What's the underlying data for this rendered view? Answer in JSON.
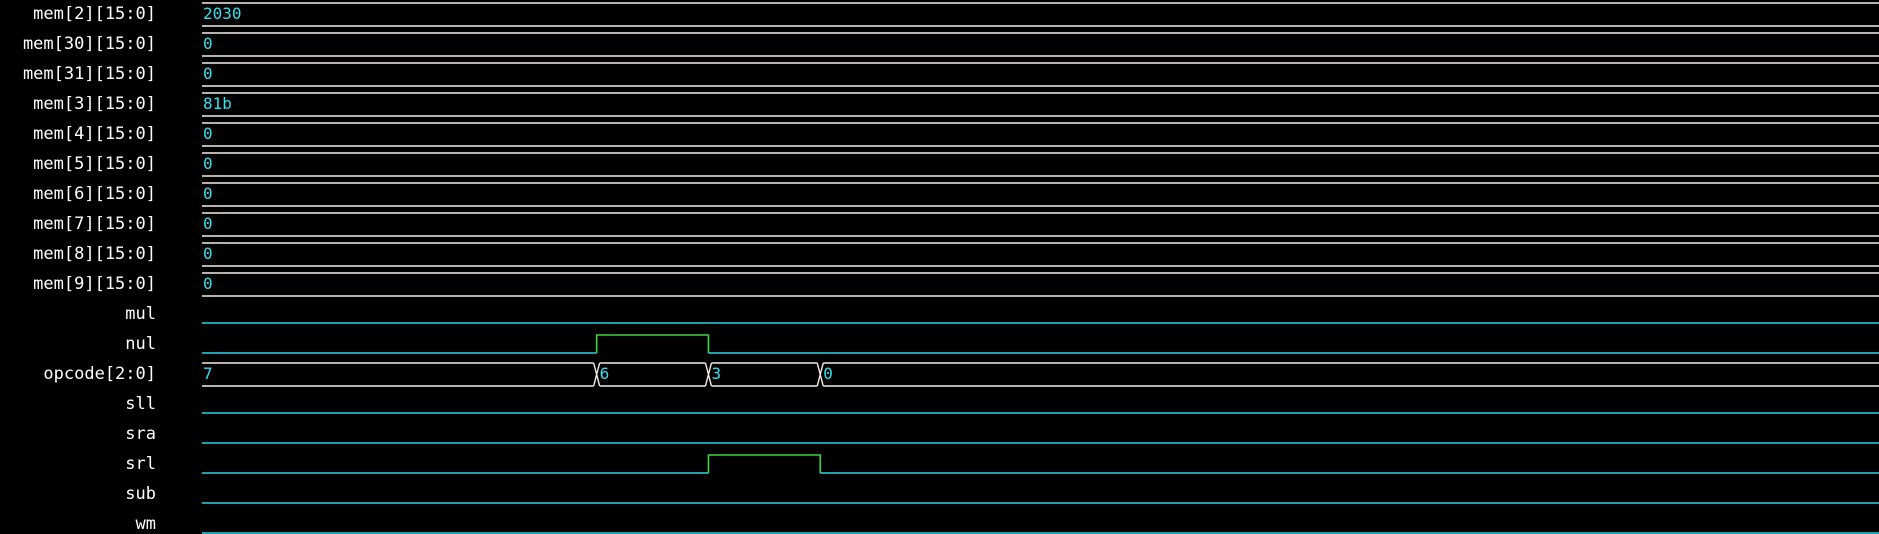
{
  "colors": {
    "background": "#000000",
    "signal_name": "#ffffff",
    "bus_line": "#f4ede6",
    "bus_value": "#34e0f0",
    "bit_low": "#2ad4e6",
    "bit_high": "#3ed63e"
  },
  "time_axis": {
    "min": 0,
    "max": 1500
  },
  "signals": [
    {
      "name": "mem[2][15:0]",
      "kind": "bus",
      "segments": [
        {
          "start": 0,
          "value": "2030"
        }
      ]
    },
    {
      "name": "mem[30][15:0]",
      "kind": "bus",
      "segments": [
        {
          "start": 0,
          "value": "0"
        }
      ]
    },
    {
      "name": "mem[31][15:0]",
      "kind": "bus",
      "segments": [
        {
          "start": 0,
          "value": "0"
        }
      ]
    },
    {
      "name": "mem[3][15:0]",
      "kind": "bus",
      "segments": [
        {
          "start": 0,
          "value": "81b"
        }
      ]
    },
    {
      "name": "mem[4][15:0]",
      "kind": "bus",
      "segments": [
        {
          "start": 0,
          "value": "0"
        }
      ]
    },
    {
      "name": "mem[5][15:0]",
      "kind": "bus",
      "segments": [
        {
          "start": 0,
          "value": "0"
        }
      ]
    },
    {
      "name": "mem[6][15:0]",
      "kind": "bus",
      "segments": [
        {
          "start": 0,
          "value": "0"
        }
      ]
    },
    {
      "name": "mem[7][15:0]",
      "kind": "bus",
      "segments": [
        {
          "start": 0,
          "value": "0"
        }
      ]
    },
    {
      "name": "mem[8][15:0]",
      "kind": "bus",
      "segments": [
        {
          "start": 0,
          "value": "0"
        }
      ]
    },
    {
      "name": "mem[9][15:0]",
      "kind": "bus",
      "segments": [
        {
          "start": 0,
          "value": "0"
        }
      ]
    },
    {
      "name": "mul",
      "kind": "bit",
      "high": []
    },
    {
      "name": "nul",
      "kind": "bit",
      "high": [
        [
          353,
          453
        ]
      ]
    },
    {
      "name": "opcode[2:0]",
      "kind": "bus",
      "segments": [
        {
          "start": 0,
          "value": "7"
        },
        {
          "start": 353,
          "value": "6"
        },
        {
          "start": 453,
          "value": "3"
        },
        {
          "start": 553,
          "value": "0"
        }
      ]
    },
    {
      "name": "sll",
      "kind": "bit",
      "high": []
    },
    {
      "name": "sra",
      "kind": "bit",
      "high": []
    },
    {
      "name": "srl",
      "kind": "bit",
      "high": [
        [
          453,
          553
        ]
      ]
    },
    {
      "name": "sub",
      "kind": "bit",
      "high": []
    },
    {
      "name": "wm",
      "kind": "bit",
      "high": []
    }
  ]
}
